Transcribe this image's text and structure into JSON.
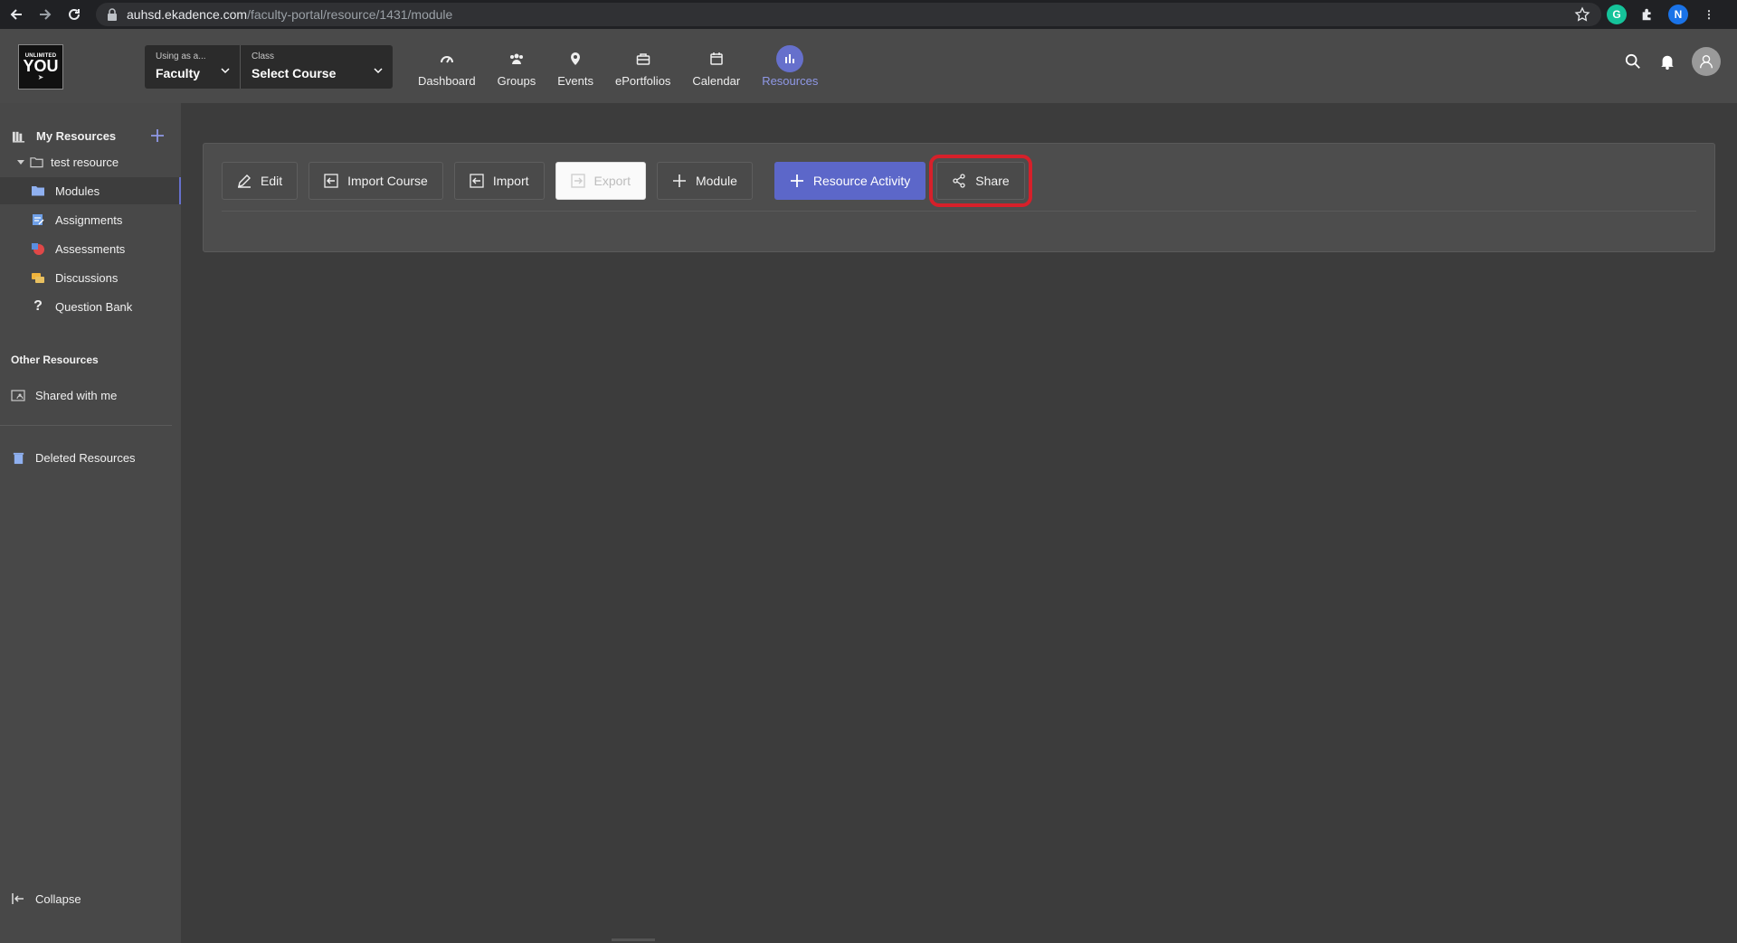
{
  "browser": {
    "url_host": "auhsd.ekadence.com",
    "url_path": "/faculty-portal/resource/1431/module",
    "profile_initial": "N"
  },
  "header": {
    "logo": {
      "line1": "UNLIMITED",
      "line2": "YOU"
    },
    "role": {
      "label": "Using as a...",
      "value": "Faculty"
    },
    "class": {
      "label": "Class",
      "value": "Select Course"
    },
    "nav": [
      {
        "label": "Dashboard",
        "icon": "gauge-icon"
      },
      {
        "label": "Groups",
        "icon": "people-icon"
      },
      {
        "label": "Events",
        "icon": "map-pin-icon"
      },
      {
        "label": "ePortfolios",
        "icon": "briefcase-icon"
      },
      {
        "label": "Calendar",
        "icon": "calendar-icon"
      },
      {
        "label": "Resources",
        "icon": "bar-chart-icon",
        "active": true
      }
    ]
  },
  "sidebar": {
    "my_resources": "My Resources",
    "tree_root": "test resource",
    "items": [
      {
        "label": "Modules",
        "icon": "folder-icon",
        "selected": true
      },
      {
        "label": "Assignments",
        "icon": "assignment-icon"
      },
      {
        "label": "Assessments",
        "icon": "assessment-icon"
      },
      {
        "label": "Discussions",
        "icon": "chat-icon"
      },
      {
        "label": "Question Bank",
        "icon": "question-icon"
      }
    ],
    "other_resources": "Other Resources",
    "shared_with_me": "Shared with me",
    "deleted_resources": "Deleted Resources",
    "collapse": "Collapse"
  },
  "toolbar": {
    "edit": "Edit",
    "import_course": "Import Course",
    "import": "Import",
    "export": "Export",
    "module": "Module",
    "resource_activity": "Resource Activity",
    "share": "Share"
  },
  "colors": {
    "accent": "#5c67c9",
    "highlight": "#d6202a",
    "background": "#3c3c3c"
  }
}
